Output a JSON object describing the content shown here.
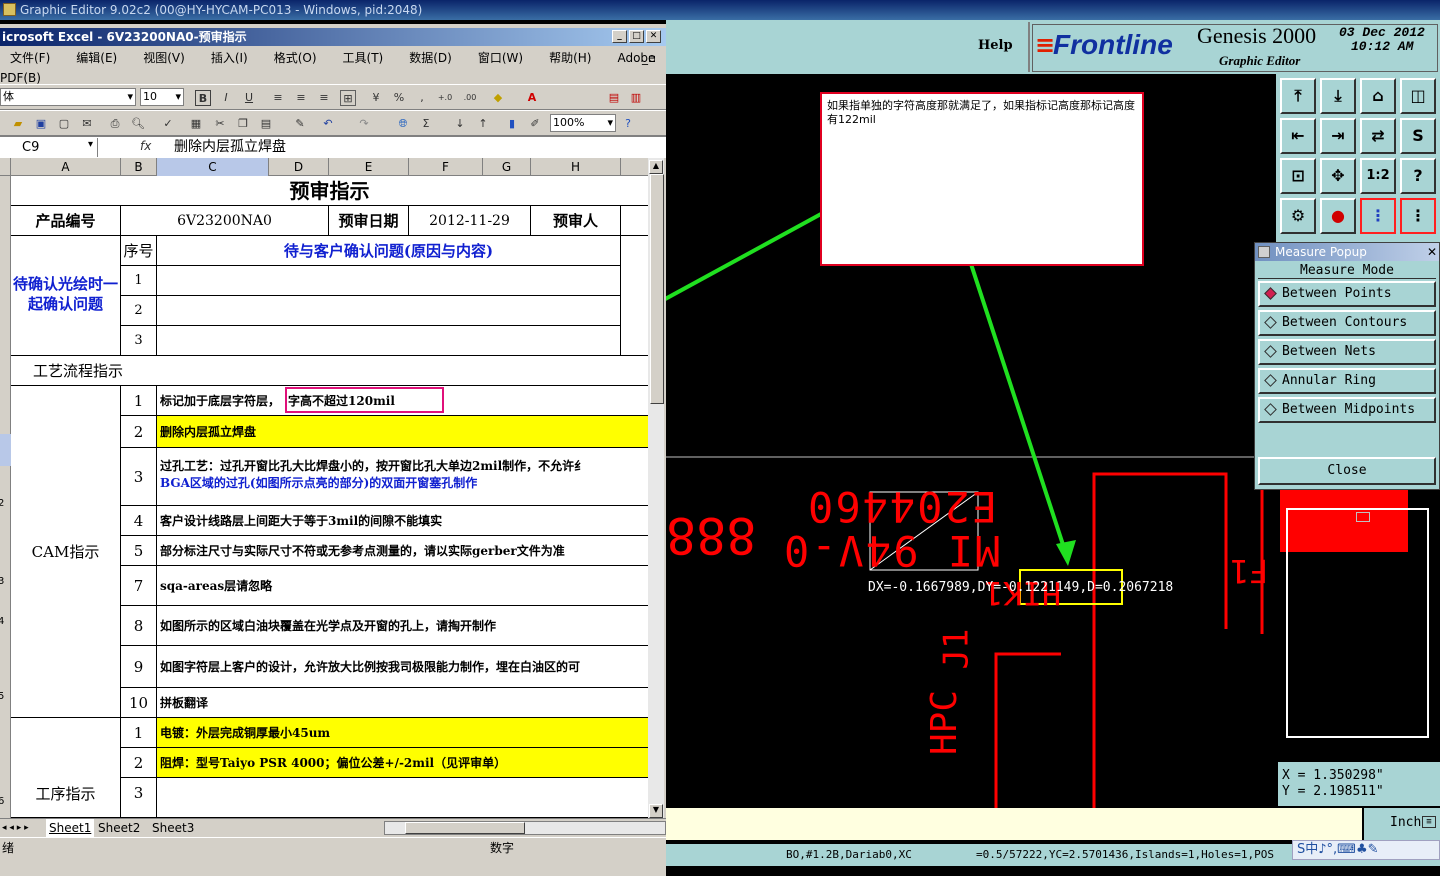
{
  "window": {
    "title": "Graphic Editor 9.02c2 (00@HY-HYCAM-PC013 - Windows, pid:2048)"
  },
  "excel": {
    "title": "icrosoft Excel - 6V23200NA0-预审指示",
    "menu": [
      "文件(F)",
      "编辑(E)",
      "视图(V)",
      "插入(I)",
      "格式(O)",
      "工具(T)",
      "数据(D)",
      "窗口(W)",
      "帮助(H)",
      "Adobe PDF(B)"
    ],
    "font_name": "体",
    "font_size": "10",
    "zoom": "100%",
    "name_box": "C9",
    "fx": "fx",
    "formula": "删除内层孤立焊盘",
    "columns": [
      "A",
      "B",
      "C",
      "D",
      "E",
      "F",
      "G",
      "H"
    ],
    "row_numbers": [
      "2",
      "3",
      "4",
      "5",
      "6"
    ],
    "sheet": {
      "title": "预审指示",
      "product_label": "产品编号",
      "product_value": "6V23200NA0",
      "date_label": "预审日期",
      "date_value": "2012-11-29",
      "reviewer_label": "预审人",
      "pending_label": "待确认光绘时一起确认问题",
      "seq_label": "序号",
      "pending_header": "待与客户确认问题(原因与内容)",
      "pending_rows": [
        "1",
        "2",
        "3"
      ],
      "process_label": "工艺流程指示",
      "cam_label": "CAM指示",
      "cam_rows": [
        {
          "n": "1",
          "t": "标记加于底层字符层，",
          "t2": "字高不超过120mil"
        },
        {
          "n": "2",
          "t": "删除内层孤立焊盘"
        },
        {
          "n": "3",
          "t": "过孔工艺：过孔开窗比孔大比焊盘小的，按开窗比孔大单边2mil制作，不允许纟",
          "t2": "BGA区域的过孔(如图所示点亮的部分)的双面开窗塞孔制作"
        },
        {
          "n": "4",
          "t": "客户设计线路层上间距大于等于3mil的间隙不能填实"
        },
        {
          "n": "5",
          "t": "部分标注尺寸与实际尺寸不符或无参考点测量的，请以实际gerber文件为准"
        },
        {
          "n": "7",
          "t": "sqa-areas层请忽略"
        },
        {
          "n": "8",
          "t": "如图所示的区域白油块覆盖在光学点及开窗的孔上，请掏开制作"
        },
        {
          "n": "9",
          "t": "如图字符层上客户的设计，允许放大比例按我司极限能力制作，埋在白油区的可"
        },
        {
          "n": "10",
          "t": "拼板翻译"
        }
      ],
      "proc_label": "工序指示",
      "proc_rows": [
        {
          "n": "1",
          "t": "电镀：外层完成铜厚最小45um"
        },
        {
          "n": "2",
          "t": "阻焊：型号Taiyo PSR 4000；偏位公差+/-2mil（见评审单）"
        },
        {
          "n": "3",
          "t": ""
        }
      ]
    },
    "sheets": [
      "Sheet1",
      "Sheet2",
      "Sheet3"
    ],
    "status_left": "绪",
    "status_num": "数字"
  },
  "genesis": {
    "help": "Help",
    "brand": "Frontline",
    "product": "Genesis 2000",
    "subtitle": "Graphic Editor",
    "date": "03 Dec 2012",
    "time": "10:12 AM",
    "measure": {
      "title": "Measure Popup",
      "mode_label": "Measure Mode",
      "modes": [
        "Between Points",
        "Between Contours",
        "Between Nets",
        "Annular Ring",
        "Between Midpoints"
      ],
      "selected": "Between Points",
      "close": "Close"
    },
    "annotation": "如果指单独的字符高度那就满足了，如果指标记高度那标记高度有122mil",
    "readout": "DX=-0.1667989,DY=-0.1221149,D=0.2067218",
    "canvas_text": {
      "t1": "E204460",
      "t2": "MI 94V-0",
      "t3": "888",
      "t4": "HIK1",
      "t5": "J1",
      "t6": "HPC",
      "t7": "F1"
    },
    "x_label": "X = 1.350298\"",
    "y_label": "Y = 2.198511\"",
    "unit": "Inch",
    "status": "=0.5/57222,YC=2.5701436,Islands=1,Holes=1,POS",
    "status_prefix": "BO,#1.2B,Dariab0,XC",
    "ime": "S中♪°,⌨♣✎"
  },
  "colors": {
    "teal": "#a8d4d4",
    "red": "#ff0000",
    "green": "#20e020",
    "yellow": "#ffff00"
  }
}
